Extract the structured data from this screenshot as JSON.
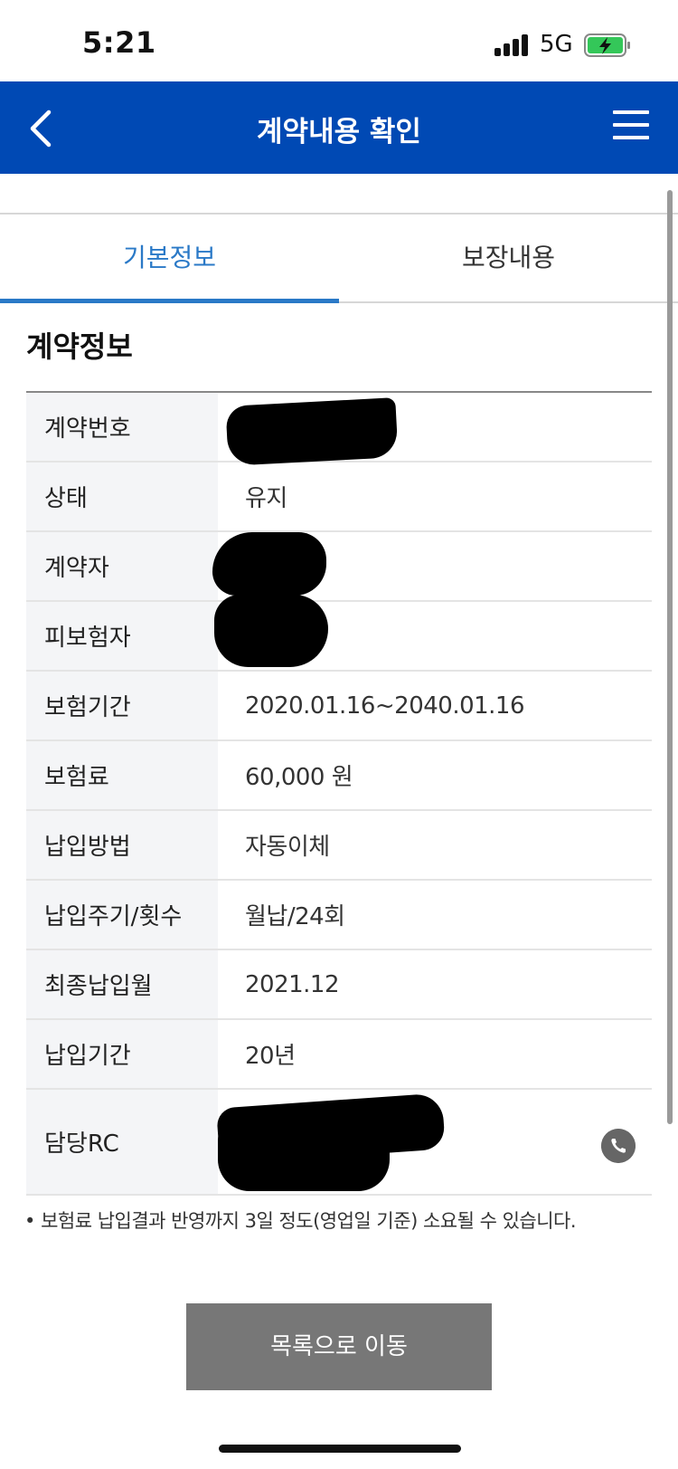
{
  "status_bar": {
    "time": "5:21",
    "network": "5G",
    "battery_color": "#34c759"
  },
  "header": {
    "title": "계약내용 확인",
    "back_icon": "chevron-left-icon",
    "menu_icon": "hamburger-menu-icon",
    "background_color": "#0049b4"
  },
  "tabs": [
    {
      "label": "기본정보",
      "active": true
    },
    {
      "label": "보장내용",
      "active": false
    }
  ],
  "section": {
    "title": "계약정보"
  },
  "rows": [
    {
      "label": "계약번호",
      "value": ""
    },
    {
      "label": "상태",
      "value": "유지"
    },
    {
      "label": "계약자",
      "value": ""
    },
    {
      "label": "피보험자",
      "value": ""
    },
    {
      "label": "보험기간",
      "value": "2020.01.16~2040.01.16"
    },
    {
      "label": "보험료",
      "value": "60,000 원"
    },
    {
      "label": "납입방법",
      "value": "자동이체"
    },
    {
      "label": "납입주기/횟수",
      "value": "월납/24회"
    },
    {
      "label": "최종납입월",
      "value": "2021.12"
    },
    {
      "label": "납입기간",
      "value": "20년"
    },
    {
      "label": "담당RC",
      "value": ""
    }
  ],
  "notice": "보험료 납입결과 반영까지 3일 정도(영업일 기준) 소요될 수 있습니다.",
  "list_button": "목록으로 이동",
  "accent_color": "#2a79c7"
}
